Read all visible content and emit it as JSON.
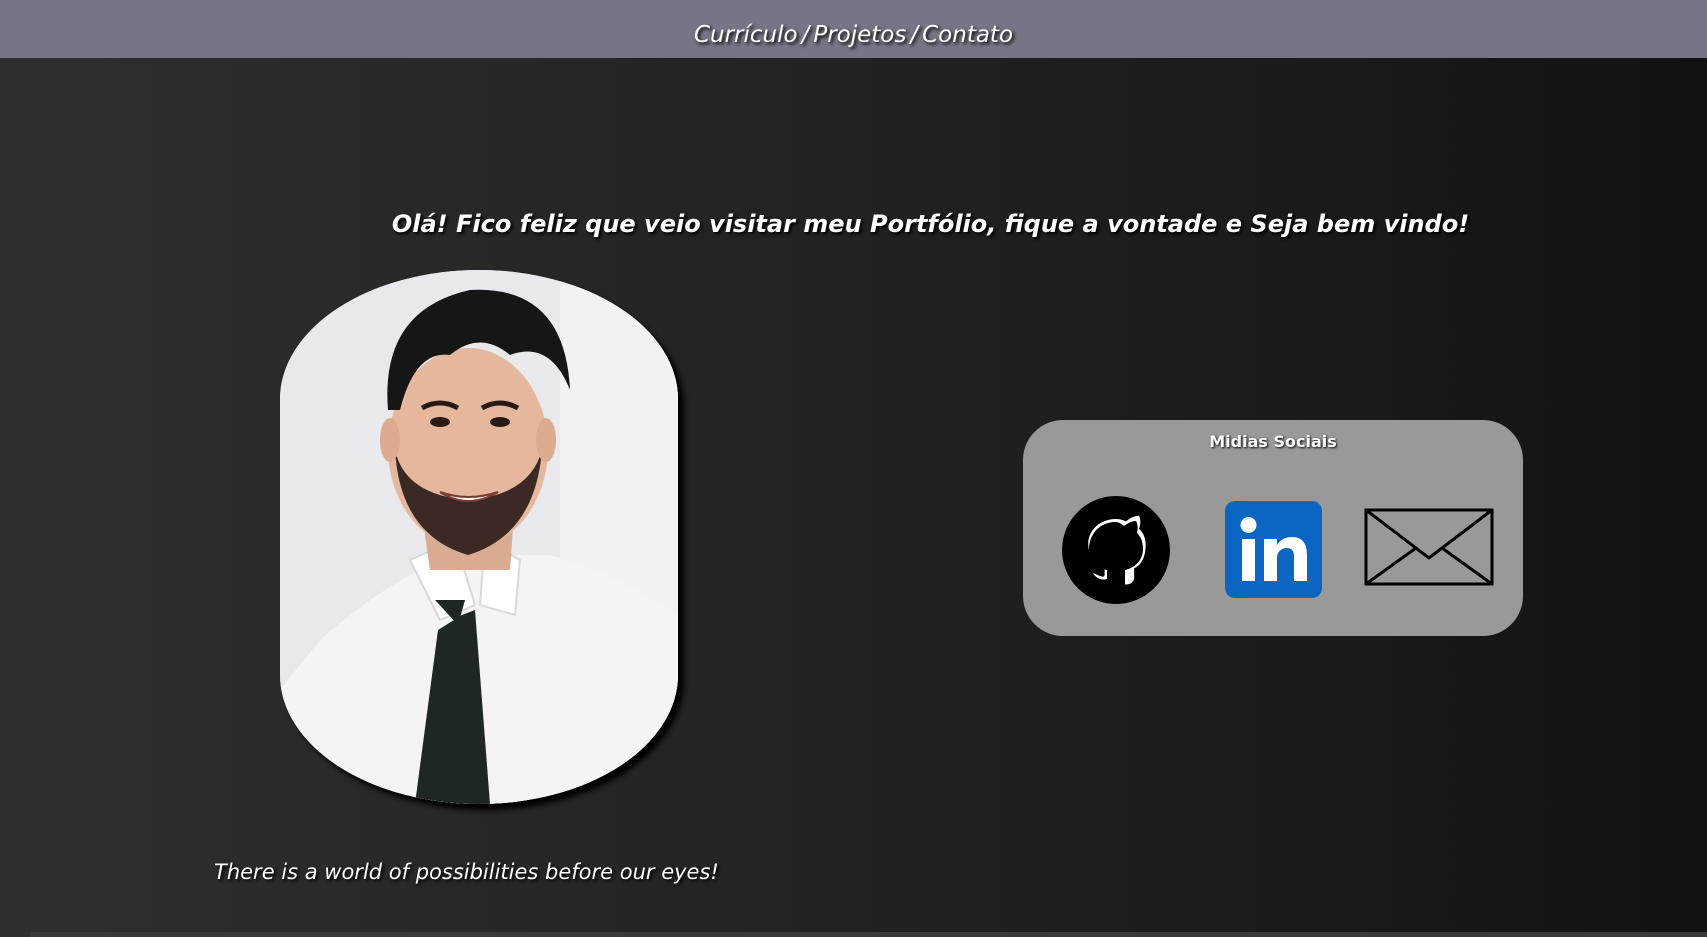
{
  "nav": {
    "items": [
      {
        "label": "Currículo"
      },
      {
        "label": "Projetos"
      },
      {
        "label": "Contato"
      }
    ],
    "separator": "/"
  },
  "hero": {
    "welcome": "Olá! Fico feliz que veio visitar meu Portfólio, fique a vontade e Seja bem vindo!",
    "tagline": "There is a world of possibilities before our eyes!"
  },
  "social": {
    "title": "Midias Sociais",
    "icons": [
      "github-icon",
      "linkedin-icon",
      "email-icon"
    ]
  },
  "colors": {
    "topbar": "#767585",
    "background_dark": "#1b1b1b",
    "card": "#9a999a",
    "linkedin": "#0a66c2",
    "text": "#ffffff"
  }
}
